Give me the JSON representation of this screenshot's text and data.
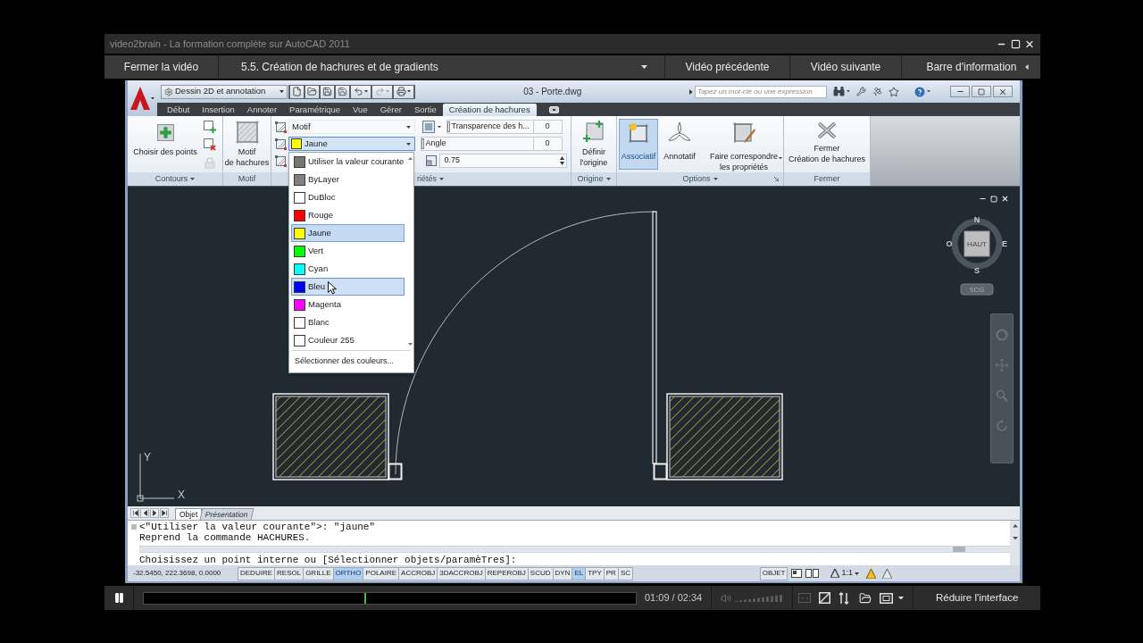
{
  "player": {
    "title": "video2brain - La formation complète sur AutoCAD 2011"
  },
  "nav": {
    "close": "Fermer la vidéo",
    "chapter": "5.5. Création de hachures et de gradients",
    "previous": "Vidéo précédente",
    "next": "Vidéo suivante",
    "info": "Barre d'information"
  },
  "autocad": {
    "workspace": "Dessin 2D et annotation",
    "file_title": "03 - Porte.dwg",
    "search": {
      "placeholder": "Tapez un mot-clé ou une expression"
    },
    "tabs": [
      {
        "label": "Début",
        "selected": false
      },
      {
        "label": "Insertion",
        "selected": false
      },
      {
        "label": "Annoter",
        "selected": false
      },
      {
        "label": "Paramétrique",
        "selected": false
      },
      {
        "label": "Vue",
        "selected": false
      },
      {
        "label": "Gérer",
        "selected": false
      },
      {
        "label": "Sortie",
        "selected": false
      },
      {
        "label": "Création de hachures",
        "selected": true
      }
    ],
    "ribbon": {
      "contours": {
        "button": "Choisir des points",
        "label": "Contours"
      },
      "pattern": {
        "lines": [
          "Motif",
          "de hachures"
        ],
        "label": "Motif"
      },
      "properties": {
        "type_combo": "Motif",
        "color_combo": {
          "value": "Jaune",
          "color": "#ffff00",
          "expanded": true
        },
        "transparency": {
          "label": "Transparence des h...",
          "value": "0",
          "level": 0
        },
        "angle": {
          "label": "Angle",
          "value": "0",
          "level": 0
        },
        "scale": "0.75",
        "label": "riétés"
      },
      "origin": {
        "lines": [
          "Définir",
          "l'origine"
        ],
        "label": "Origine"
      },
      "options": {
        "buttons": [
          {
            "kind": "associative",
            "lines": [
              "Associatif"
            ],
            "selected": true
          },
          {
            "kind": "annotative",
            "lines": [
              "Annotatif"
            ],
            "selected": false
          },
          {
            "kind": "match",
            "lines": [
              "Faire correspondre",
              "les propriétés"
            ],
            "selected": false
          }
        ],
        "label": "Options"
      },
      "close": {
        "lines": [
          "Fermer",
          "Création de hachures"
        ],
        "label": "Fermer"
      }
    },
    "color_menu": {
      "items": [
        {
          "label": "Utiliser la valeur courante",
          "color": "#767676",
          "selected": false,
          "hovered": false
        },
        {
          "label": "ByLayer",
          "color": "#808080",
          "selected": false,
          "hovered": false
        },
        {
          "label": "DuBloc",
          "color": "#ffffff",
          "selected": false,
          "hovered": false
        },
        {
          "label": "Rouge",
          "color": "#ff0000",
          "selected": false,
          "hovered": false
        },
        {
          "label": "Jaune",
          "color": "#ffff00",
          "selected": true,
          "hovered": false
        },
        {
          "label": "Vert",
          "color": "#00ff00",
          "selected": false,
          "hovered": false
        },
        {
          "label": "Cyan",
          "color": "#00ffff",
          "selected": false,
          "hovered": false
        },
        {
          "label": "Bleu",
          "color": "#0000ff",
          "selected": false,
          "hovered": true
        },
        {
          "label": "Magenta",
          "color": "#ff00ff",
          "selected": false,
          "hovered": false
        },
        {
          "label": "Blanc",
          "color": "#fefefe",
          "selected": false,
          "hovered": false
        },
        {
          "label": "Couleur 255",
          "color": "#fdfdfd",
          "selected": false,
          "hovered": false
        }
      ],
      "footer": "Sélectionner des couleurs..."
    },
    "viewcube": {
      "face": "HAUT",
      "north": "N",
      "east": "E",
      "south": "S",
      "west": "O",
      "ucs": "SCG"
    },
    "axes": {
      "x": "X",
      "y": "Y"
    },
    "layout_tabs": [
      {
        "label": "Objet",
        "selected": true
      },
      {
        "label": "Présentation",
        "selected": false
      }
    ],
    "command": {
      "history": [
        "<\"Utiliser la valeur courante\">: \"jaune\"",
        "Reprend la commande HACHURES."
      ],
      "prompt": "Choisissez un point interne ou [Sélectionner objets/paramèTres]:"
    },
    "status": {
      "coordinates": "-32.5450, 222.3698, 0.0000",
      "toggles": [
        {
          "label": "DEDUIRE",
          "on": false
        },
        {
          "label": "RESOL",
          "on": false
        },
        {
          "label": "GRILLE",
          "on": false
        },
        {
          "label": "ORTHO",
          "on": true
        },
        {
          "label": "POLAIRE",
          "on": false
        },
        {
          "label": "ACCROBJ",
          "on": false
        },
        {
          "label": "3DACCROBJ",
          "on": false
        },
        {
          "label": "REPEROBJ",
          "on": false
        },
        {
          "label": "SCUD",
          "on": false
        },
        {
          "label": "DYN",
          "on": false
        },
        {
          "label": "EL",
          "on": true
        },
        {
          "label": "TPY",
          "on": false
        },
        {
          "label": "PR",
          "on": false
        },
        {
          "label": "SC",
          "on": false
        }
      ],
      "space": "OBJET",
      "scale": "1:1"
    }
  },
  "controls": {
    "playing": true,
    "progress": {
      "level": 0.448
    },
    "time": "01:09 / 02:34",
    "collapse": "Réduire l'interface"
  }
}
